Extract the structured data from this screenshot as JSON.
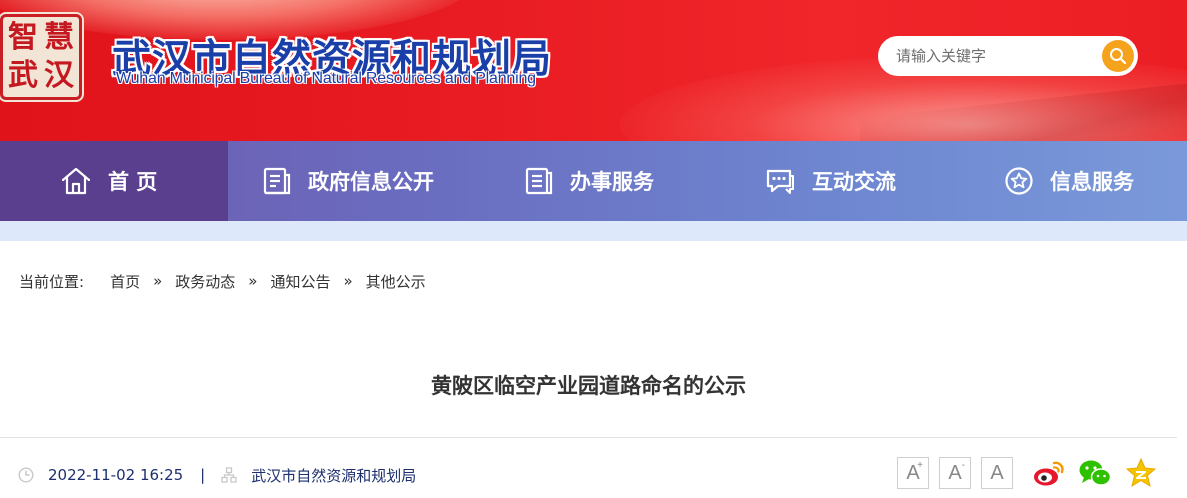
{
  "header": {
    "seal_chars": [
      "智",
      "慧",
      "武",
      "汉"
    ],
    "title": "武汉市自然资源和规划局",
    "subtitle": "Wuhan Municipal Bureau of Natural Resources and Planning",
    "colors": {
      "banner": "#e81c22",
      "title": "#1a3fa8",
      "search_button": "#f5a21c"
    }
  },
  "search": {
    "placeholder": "请输入关键字",
    "value": "",
    "button_icon": "search-icon"
  },
  "nav": {
    "items": [
      {
        "label": "首 页",
        "icon": "home-icon",
        "active": true
      },
      {
        "label": "政府信息公开",
        "icon": "document-icon",
        "active": false
      },
      {
        "label": "办事服务",
        "icon": "list-document-icon",
        "active": false
      },
      {
        "label": "互动交流",
        "icon": "chat-icon",
        "active": false
      },
      {
        "label": "信息服务",
        "icon": "star-circle-icon",
        "active": false
      }
    ]
  },
  "breadcrumb": {
    "prefix": "当前位置:",
    "items": [
      "首页",
      "政务动态",
      "通知公告",
      "其他公示"
    ],
    "separator": "»"
  },
  "article": {
    "title": "黄陂区临空产业园道路命名的公示",
    "date": "2022-11-02 16:25",
    "separator": "|",
    "source": "武汉市自然资源和规划局"
  },
  "font_size_buttons": [
    {
      "label": "A",
      "sup": "+",
      "icon": "font-increase-icon"
    },
    {
      "label": "A",
      "sup": "-",
      "icon": "font-decrease-icon"
    },
    {
      "label": "A",
      "sup": "",
      "icon": "font-reset-icon"
    }
  ],
  "share": [
    "weibo-icon",
    "wechat-icon",
    "qzone-icon"
  ]
}
